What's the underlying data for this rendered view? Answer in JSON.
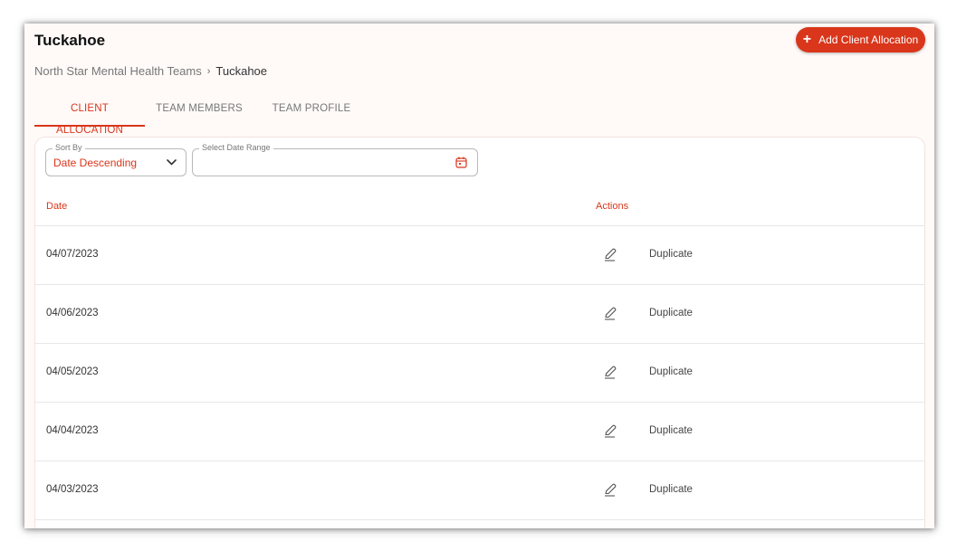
{
  "page": {
    "title": "Tuckahoe"
  },
  "header": {
    "add_button_label": "Add Client Allocation",
    "add_button_icon": "plus-icon"
  },
  "breadcrumb": {
    "parent": "North Star Mental Health Teams",
    "separator": "›",
    "current": "Tuckahoe"
  },
  "tabs": [
    {
      "label": "CLIENT ALLOCATION",
      "active": true
    },
    {
      "label": "TEAM MEMBERS",
      "active": false
    },
    {
      "label": "TEAM PROFILE",
      "active": false
    }
  ],
  "filters": {
    "sort_label": "Sort By",
    "sort_value": "Date Descending",
    "date_range_label": "Select Date Range",
    "date_range_value": ""
  },
  "table": {
    "columns": {
      "date": "Date",
      "actions": "Actions"
    },
    "rows": [
      {
        "date": "04/07/2023",
        "action": "Duplicate"
      },
      {
        "date": "04/06/2023",
        "action": "Duplicate"
      },
      {
        "date": "04/05/2023",
        "action": "Duplicate"
      },
      {
        "date": "04/04/2023",
        "action": "Duplicate"
      },
      {
        "date": "04/03/2023",
        "action": "Duplicate"
      }
    ]
  },
  "colors": {
    "accent": "#d9361b",
    "background": "#fffaf8"
  }
}
